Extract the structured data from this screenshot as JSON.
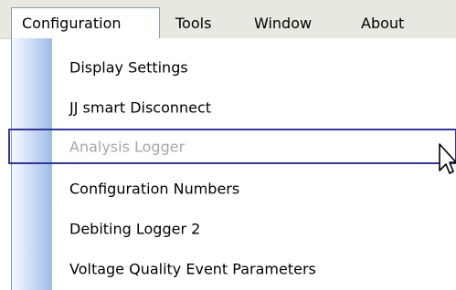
{
  "menubar": {
    "items": [
      {
        "label": "Configuration"
      },
      {
        "label": "Tools"
      },
      {
        "label": "Window"
      },
      {
        "label": "About"
      }
    ]
  },
  "dropdown": {
    "items": [
      {
        "label": "Display Settings",
        "enabled": true
      },
      {
        "label": "JJ smart Disconnect",
        "enabled": true
      },
      {
        "label": "Analysis Logger",
        "enabled": false,
        "hovered": true
      },
      {
        "label": "Configuration Numbers",
        "enabled": true
      },
      {
        "label": "Debiting Logger 2",
        "enabled": true
      },
      {
        "label": "Voltage Quality Event Parameters",
        "enabled": true
      }
    ]
  },
  "colors": {
    "menubar_bg": "#e9e8e0",
    "highlight_border": "#31379a",
    "disabled_text": "#a7a6aa",
    "gutter_blue": "#9ebbe8"
  },
  "cursor": {
    "icon": "arrow-pointer-icon"
  }
}
